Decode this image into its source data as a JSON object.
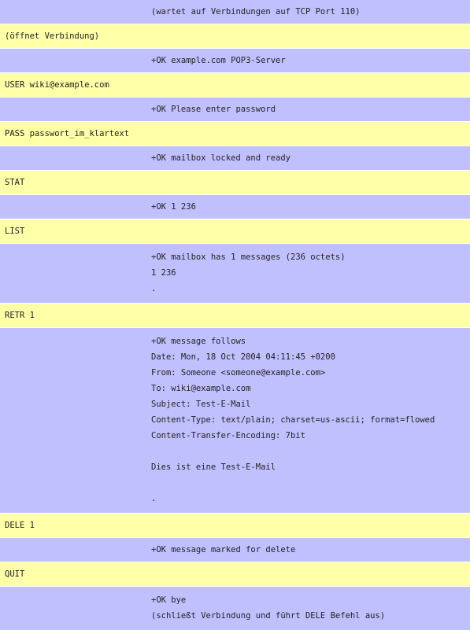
{
  "transcript": [
    {
      "role": "server",
      "lines": [
        "(wartet auf Verbindungen auf TCP Port 110)"
      ]
    },
    {
      "role": "client",
      "lines": [
        "(öffnet Verbindung)"
      ]
    },
    {
      "role": "server",
      "lines": [
        "+OK example.com POP3-Server"
      ]
    },
    {
      "role": "client",
      "lines": [
        "USER wiki@example.com"
      ]
    },
    {
      "role": "server",
      "lines": [
        "+OK Please enter password"
      ]
    },
    {
      "role": "client",
      "lines": [
        "PASS passwort_im_klartext"
      ]
    },
    {
      "role": "server",
      "lines": [
        "+OK mailbox locked and ready"
      ]
    },
    {
      "role": "client",
      "lines": [
        "STAT"
      ]
    },
    {
      "role": "server",
      "lines": [
        "+OK 1 236"
      ]
    },
    {
      "role": "client",
      "lines": [
        "LIST"
      ]
    },
    {
      "role": "server",
      "lines": [
        "+OK mailbox has 1 messages (236 octets)",
        "1 236",
        "."
      ]
    },
    {
      "role": "client",
      "lines": [
        "RETR 1"
      ]
    },
    {
      "role": "server",
      "lines": [
        "+OK message follows",
        "Date: Mon, 18 Oct 2004 04:11:45 +0200",
        "From: Someone <someone@example.com>",
        "To: wiki@example.com",
        "Subject: Test-E-Mail",
        "Content-Type: text/plain; charset=us-ascii; format=flowed",
        "Content-Transfer-Encoding: 7bit",
        "",
        "Dies ist eine Test-E-Mail",
        "",
        "."
      ]
    },
    {
      "role": "client",
      "lines": [
        "DELE 1"
      ]
    },
    {
      "role": "server",
      "lines": [
        "+OK message marked for delete"
      ]
    },
    {
      "role": "client",
      "lines": [
        "QUIT"
      ]
    },
    {
      "role": "server",
      "lines": [
        "+OK bye",
        "(schließt Verbindung und führt DELE Befehl aus)"
      ]
    }
  ],
  "colors": {
    "client_row": "#ffffa8",
    "server_row": "#c0c0ff"
  }
}
